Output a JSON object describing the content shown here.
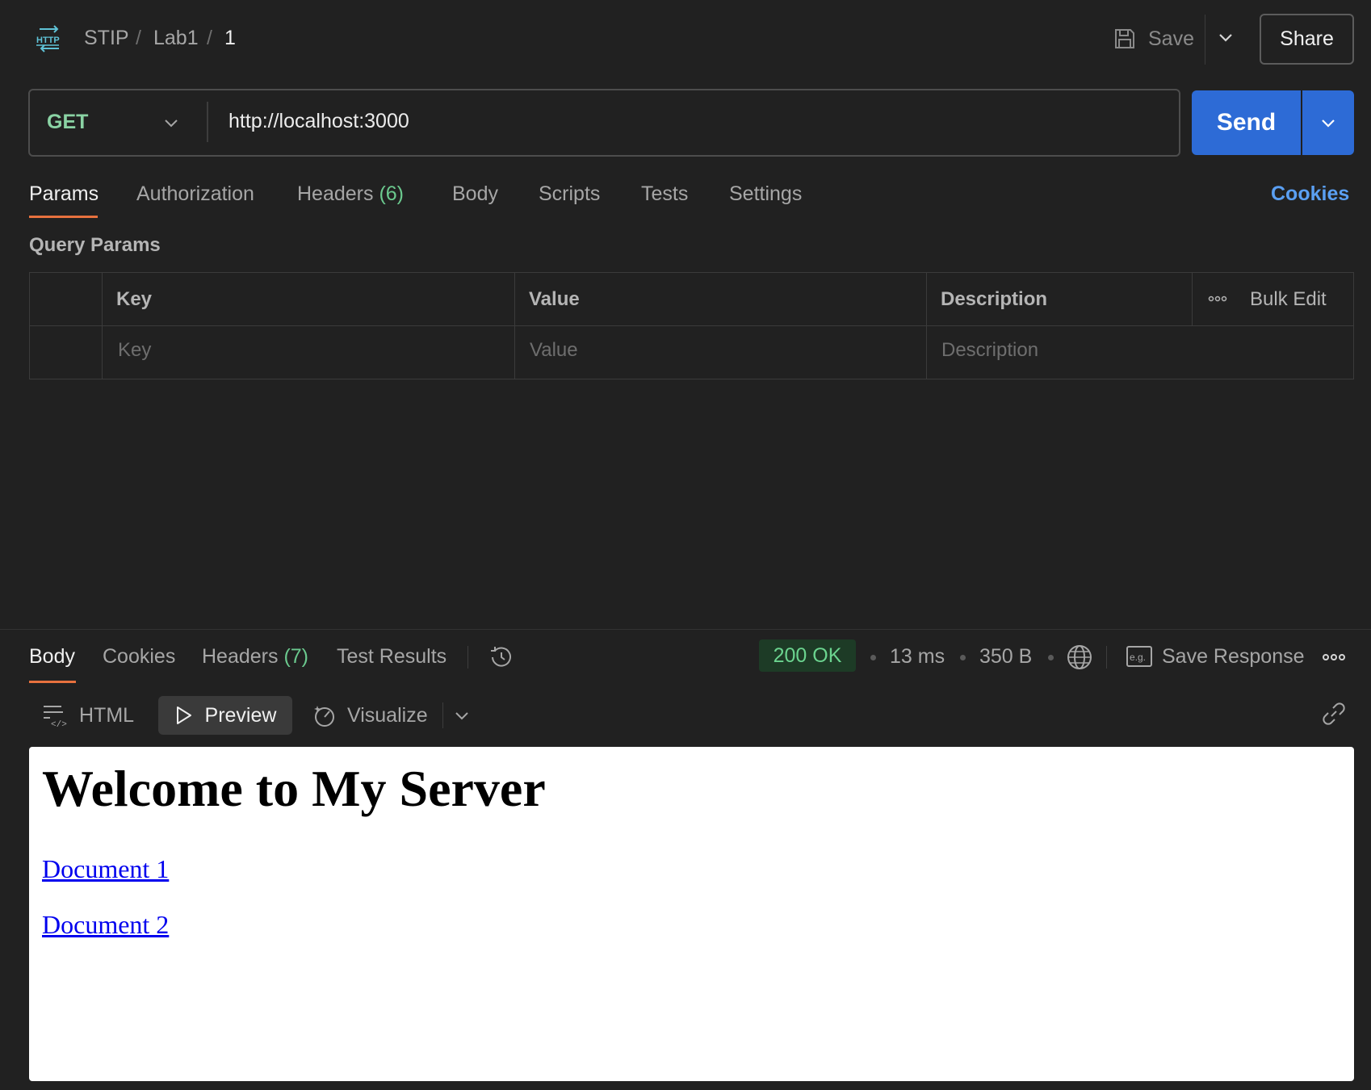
{
  "breadcrumb": {
    "icon": "http-request-icon",
    "items": [
      "STIP",
      "Lab1",
      "1"
    ],
    "separator": "/"
  },
  "toolbar": {
    "save_label": "Save",
    "share_label": "Share"
  },
  "request": {
    "method": "GET",
    "url": "http://localhost:3000",
    "send_label": "Send"
  },
  "request_tabs": {
    "params": "Params",
    "authorization": "Authorization",
    "headers": "Headers",
    "headers_count": "(6)",
    "body": "Body",
    "scripts": "Scripts",
    "tests": "Tests",
    "settings": "Settings",
    "cookies": "Cookies"
  },
  "query_params": {
    "title": "Query Params",
    "columns": [
      "Key",
      "Value",
      "Description"
    ],
    "bulk_edit": "Bulk Edit",
    "placeholders": {
      "key": "Key",
      "value": "Value",
      "description": "Description"
    }
  },
  "response_tabs": {
    "body": "Body",
    "cookies": "Cookies",
    "headers": "Headers",
    "headers_count": "(7)",
    "test_results": "Test Results"
  },
  "response_meta": {
    "status": "200 OK",
    "time": "13 ms",
    "size": "350 B",
    "save_response": "Save Response",
    "status_color": "#6bd48f"
  },
  "view_modes": {
    "html": "HTML",
    "preview": "Preview",
    "visualize": "Visualize"
  },
  "preview": {
    "heading": "Welcome to My Server",
    "links": [
      "Document 1",
      "Document 2"
    ]
  },
  "colors": {
    "accent_orange": "#e8713e",
    "send_blue": "#2d6bd6",
    "link_blue": "#5a9ff2",
    "method_green": "#8ad3a4"
  }
}
